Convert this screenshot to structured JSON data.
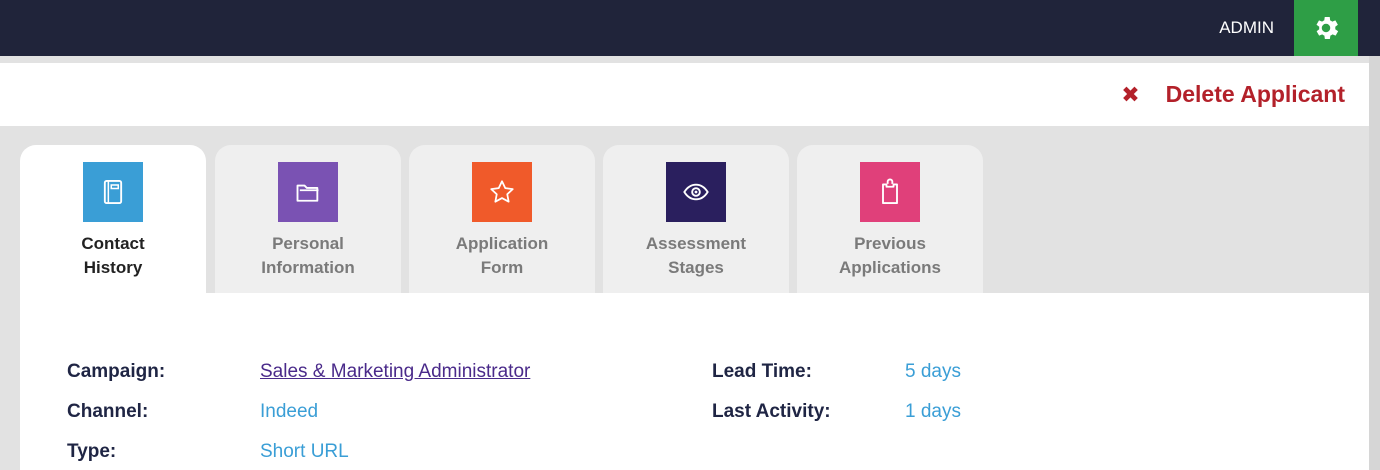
{
  "topbar": {
    "user_label": "ADMIN",
    "settings_icon": "gear-icon",
    "background": "#20243a",
    "settings_color": "#2e9e46"
  },
  "actions": {
    "delete_label": "Delete Applicant",
    "delete_icon": "close-icon",
    "delete_color": "#b3212a"
  },
  "tabs": [
    {
      "line1": "Contact",
      "line2": "History",
      "icon": "notebook-icon",
      "color": "#3a9ed6",
      "active": true
    },
    {
      "line1": "Personal",
      "line2": "Information",
      "icon": "folder-icon",
      "color": "#7a52b3",
      "active": false
    },
    {
      "line1": "Application",
      "line2": "Form",
      "icon": "star-icon",
      "color": "#f05a2a",
      "active": false
    },
    {
      "line1": "Assessment",
      "line2": "Stages",
      "icon": "eye-icon",
      "color": "#2a1f5e",
      "active": false
    },
    {
      "line1": "Previous",
      "line2": "Applications",
      "icon": "clipboard-icon",
      "color": "#e0407a",
      "active": false
    }
  ],
  "details": {
    "campaign_label": "Campaign:",
    "campaign_value": "Sales & Marketing Administrator",
    "channel_label": "Channel:",
    "channel_value": "Indeed",
    "type_label": "Type:",
    "type_value": "Short URL",
    "lead_time_label": "Lead Time:",
    "lead_time_value": "5 days",
    "last_activity_label": "Last Activity:",
    "last_activity_value": "1 days"
  }
}
